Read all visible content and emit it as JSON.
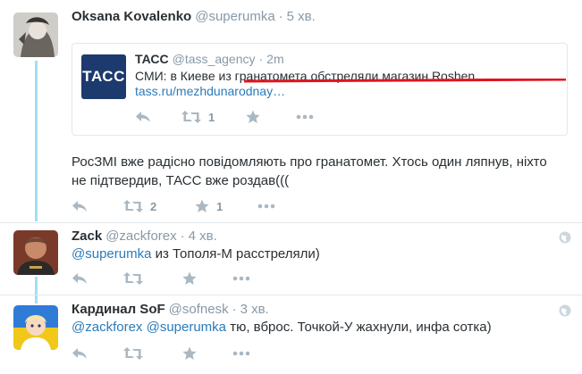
{
  "tweet_main": {
    "name": "Oksana Kovalenko",
    "handle": "@superumka",
    "separator": "·",
    "time": "5 хв.",
    "quoted": {
      "name": "ТАСС",
      "handle": "@tass_agency",
      "separator": "·",
      "time": "2m",
      "logo_text": "ТАСС",
      "text_prefix": "СМИ: ",
      "text_highlight": "в Киеве из гранатомета обстреляли магазин Roshen",
      "link": "tass.ru/mezhdunarodnay…",
      "retweet_count": "1"
    },
    "text_line1": "РосЗМІ вже радісно повідомляють про гранатомет. Хтось один ляпнув, ніхто",
    "text_line2": "не підтвердив, ТАСС вже роздав(((",
    "retweet_count": "2",
    "favorite_count": "1"
  },
  "reply1": {
    "name": "Zack",
    "handle": "@zackforex",
    "separator": "·",
    "time": "4 хв.",
    "mention": "@superumka",
    "text": " из Тополя-М расстреляли)"
  },
  "reply2": {
    "name": "Кардинал SoF",
    "handle": "@sofnesk",
    "separator": "·",
    "time": "3 хв.",
    "mention1": "@zackforex",
    "mention2": "@superumka",
    "text": " тю, вброс. Точкой-У жахнули, инфа сотка)"
  },
  "colors": {
    "accent": "#2b7bb9",
    "thread_line": "#a0dff5",
    "underline": "#e0141e",
    "tass_blue": "#1d3a6e"
  },
  "icons": [
    "reply-icon",
    "retweet-icon",
    "favorite-icon",
    "more-icon",
    "globe-icon"
  ]
}
